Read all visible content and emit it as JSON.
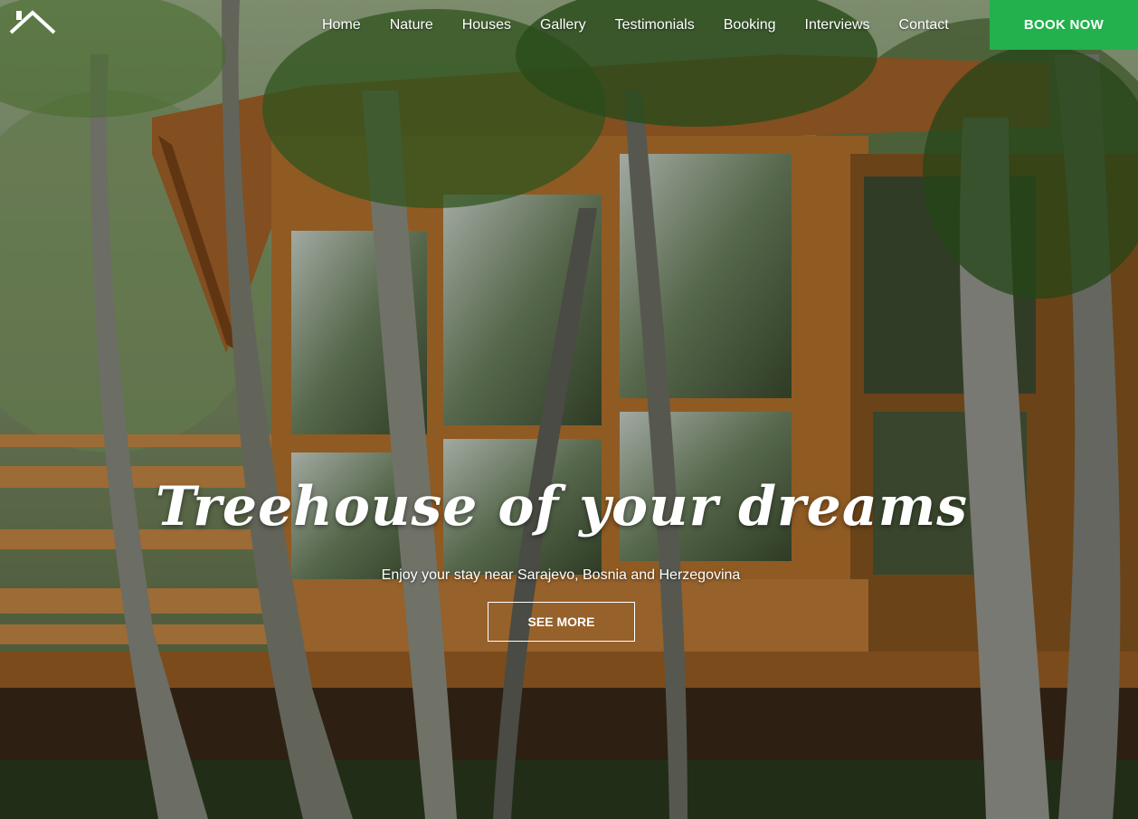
{
  "nav": {
    "items": [
      "Home",
      "Nature",
      "Houses",
      "Gallery",
      "Testimonials",
      "Booking",
      "Interviews",
      "Contact"
    ],
    "book_label": "BOOK NOW"
  },
  "hero": {
    "headline": "Treehouse of your dreams",
    "subtitle": "Enjoy your stay near Sarajevo, Bosnia and Herzegovina",
    "cta_label": "SEE MORE",
    "background": "photo of a wooden treehouse among trees"
  },
  "colors": {
    "accent": "#22b14c",
    "text": "#ffffff",
    "wood": "#b8752e"
  }
}
